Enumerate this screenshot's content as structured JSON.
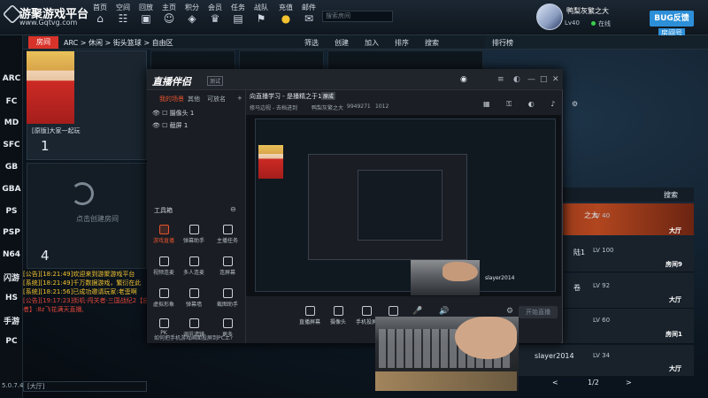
{
  "topbar": {
    "app_title": "游聚游戏平台",
    "app_url": "www.Gqtvg.com",
    "nav": [
      "首页",
      "空间",
      "回放",
      "主页",
      "积分",
      "会员",
      "任务",
      "战队",
      "充值",
      "邮件"
    ],
    "search_placeholder": "搜索房间",
    "user_name": "鸭梨灰繁之大",
    "user_level": "Lv40",
    "user_status": "在线",
    "bug_button": "BUG反馈",
    "room_label": "房间号",
    "room_id": "9949273"
  },
  "leftbar": {
    "items": [
      "ARC",
      "FC",
      "MD",
      "SFC",
      "GB",
      "GBA",
      "PS",
      "PSP",
      "N64",
      "闪游",
      "HS",
      "手游",
      "PC"
    ],
    "version": "5.0.7.40"
  },
  "main": {
    "room_tab": "房间",
    "breadcrumb": "ARC > 休闲 > 街头篮球 > 自由区",
    "actions": [
      "筛选",
      "创建",
      "加入",
      "排序",
      "搜索"
    ],
    "card1_title": "[原版]大家一起玩",
    "card1_num": "1",
    "create_room": "点击创建房间",
    "card2_num": "4"
  },
  "chat": {
    "lines": [
      {
        "text": "[公告][18:21:49]欢迎来到游聚游戏平台",
        "color": "yellow"
      },
      {
        "text": "[系统][18:21:49]千万数据游戏，繁衍在此",
        "color": "yellow"
      },
      {
        "text": "[系统][18:21:56]已成功邀请玩家:老歪啊",
        "color": "yellow"
      },
      {
        "text": "[公告][19:17:23]街机·闯关者·三国战纪2【自",
        "color": "red"
      },
      {
        "text": "者】:8z飞花满天直播,",
        "color": "red"
      }
    ],
    "input_value": "[大厅]"
  },
  "rightpane": {
    "rank_title": "排行榜",
    "search_label": "搜索",
    "rows": [
      {
        "name": "之大",
        "level": "LV 40",
        "kind": "大厅"
      },
      {
        "name": "陆1",
        "level": "LV 100",
        "kind": "房间9"
      },
      {
        "name": "卷",
        "level": "LV 92",
        "kind": "大厅"
      },
      {
        "name": "",
        "level": "LV 60",
        "kind": "房间1"
      },
      {
        "name": "slayer2014",
        "level": "LV 34",
        "kind": "大厅"
      }
    ],
    "pager_text": "1/2",
    "pager_prev": "<",
    "pager_next": ">"
  },
  "stream": {
    "logo": "直播伴侣",
    "version": "测试",
    "tabs": [
      "我的场景",
      "其他",
      "可放名"
    ],
    "scenes": [
      "摄像头 1",
      "截屏 1"
    ],
    "tools_heading": "工具箱",
    "tools": [
      "游戏直播",
      "弹幕助手",
      "主播任务",
      "视频连麦",
      "多人连麦",
      "连屏幕",
      "虚拟形象",
      "弹幕墙",
      "截图助手",
      "PK",
      "调节滤镜",
      "更多"
    ],
    "hint": "如何把手机游戏画面投屏到PC上?",
    "stream_title": "向直播学习 - 是播精之于1",
    "stream_badge": "原成",
    "sub_info": [
      "修马边视 - 去档进到",
      "鸭梨灰繁之大",
      "9949271",
      "1012"
    ],
    "bottom_buttons": [
      "直播屏幕",
      "摄像头",
      "手机投屏",
      "视频"
    ],
    "live_button": "开始直播"
  },
  "preview_names": [
    "slayer2014"
  ]
}
